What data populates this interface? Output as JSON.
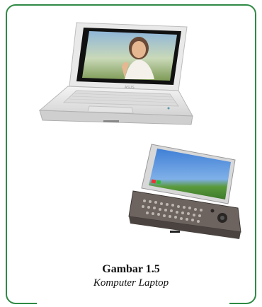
{
  "figure": {
    "caption_title": "Gambar 1.5",
    "caption_subtitle": "Komputer Laptop",
    "laptop_screen_logo": "ASUS",
    "frame_color": "#2f8a45"
  }
}
